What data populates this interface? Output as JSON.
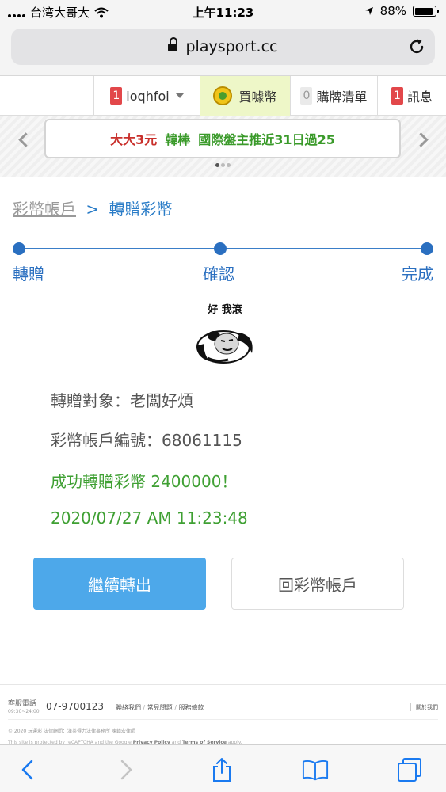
{
  "status_bar": {
    "carrier": "台湾大哥大",
    "time": "上午11:23",
    "battery_percent": "88%",
    "battery_level": 0.88
  },
  "browser": {
    "url": "playsport.cc",
    "icons": [
      "lock-icon",
      "reload-icon",
      "back-icon",
      "forward-icon",
      "share-icon",
      "bookmarks-icon",
      "tabs-icon"
    ]
  },
  "site_nav": {
    "user": {
      "badge": "1",
      "name": "ioqhfoi"
    },
    "buy_coins": "買噱幣",
    "purchase_list": {
      "badge": "0",
      "label": "購牌清單"
    },
    "messages": {
      "badge": "1",
      "label": "訊息"
    }
  },
  "banner": {
    "part1": "大大3元",
    "part2": "韓棒",
    "part3": "國際盤主推近31日過25"
  },
  "breadcrumb": {
    "parent": "彩幣帳戶",
    "separator": ">",
    "current": "轉贈彩幣"
  },
  "steps": [
    "轉贈",
    "確認",
    "完成"
  ],
  "sticker": {
    "caption": "好 我滾"
  },
  "result": {
    "recipient": "轉贈對象：老闆好煩",
    "account_number": "彩幣帳戶編號：68061115",
    "success_message": "成功轉贈彩幣 2400000！",
    "timestamp": "2020/07/27 AM 11:23:48"
  },
  "buttons": {
    "continue": "繼續轉出",
    "back_to_account": "回彩幣帳戶"
  },
  "footer": {
    "service_label": "客服電話",
    "service_hours": "09:30~24:00",
    "phone": "07-9700123",
    "links": [
      "聯絡我們",
      "常見問題",
      "服務條款"
    ],
    "about": "關於我們",
    "copyright": "© 2020 玩運彩 法律顧問：漢英得力法律事務所 陳鎮宏律師",
    "recaptcha_prefix": "This site is protected by reCAPTCHA and the Google",
    "privacy_policy": "Privacy Policy",
    "and": "and",
    "terms": "Terms of Service",
    "apply": "apply."
  }
}
